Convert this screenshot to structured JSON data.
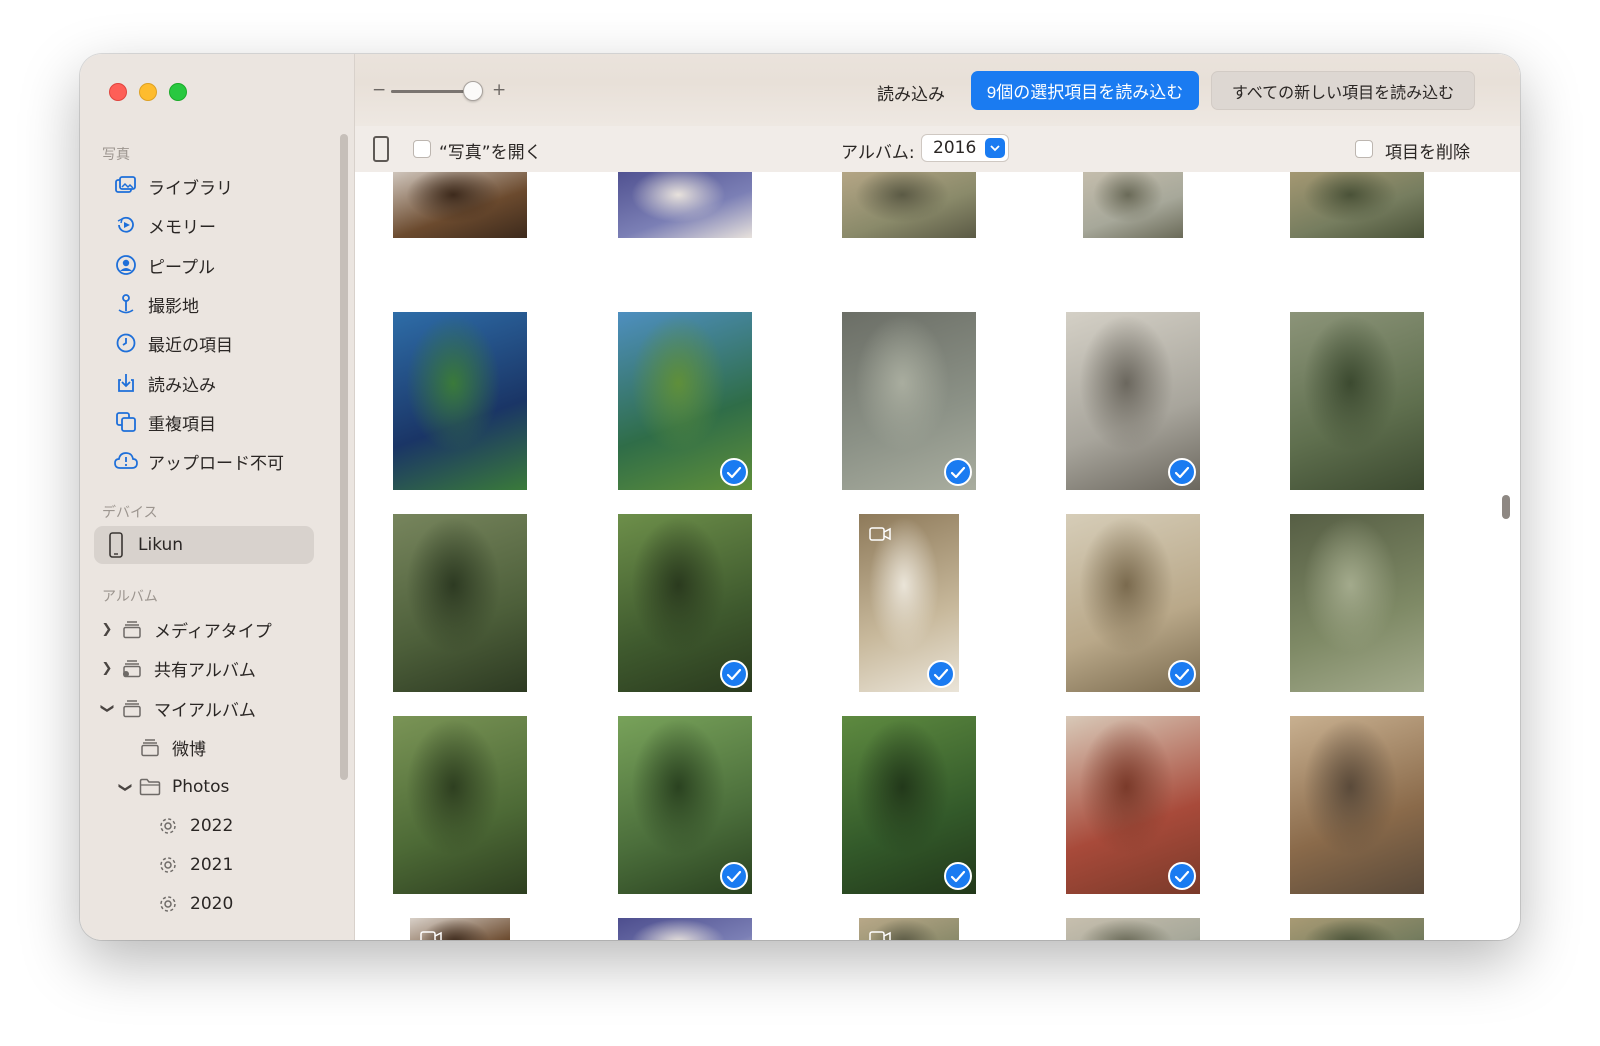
{
  "sidebar": {
    "sections": {
      "photos": "写真",
      "devices": "デバイス",
      "albums": "アルバム"
    },
    "library_items": [
      {
        "label": "ライブラリ",
        "icon": "library-icon"
      },
      {
        "label": "メモリー",
        "icon": "memories-icon"
      },
      {
        "label": "ピープル",
        "icon": "people-icon"
      },
      {
        "label": "撮影地",
        "icon": "places-icon"
      },
      {
        "label": "最近の項目",
        "icon": "recents-icon"
      },
      {
        "label": "読み込み",
        "icon": "imports-icon"
      },
      {
        "label": "重複項目",
        "icon": "duplicates-icon"
      },
      {
        "label": "アップロード不可",
        "icon": "upload-error-icon"
      }
    ],
    "device": {
      "label": "Likun",
      "icon": "iphone-icon"
    },
    "album_items": [
      {
        "label": "メディアタイプ",
        "expanded": false,
        "icon": "album-stack-icon"
      },
      {
        "label": "共有アルバム",
        "expanded": false,
        "icon": "shared-album-icon"
      },
      {
        "label": "マイアルバム",
        "expanded": true,
        "icon": "album-stack-icon"
      },
      {
        "label": "微博",
        "icon": "album-stack-icon"
      },
      {
        "label": "Photos",
        "expanded": true,
        "icon": "folder-icon"
      },
      {
        "label": "2022",
        "icon": "smart-album-gear-icon"
      },
      {
        "label": "2021",
        "icon": "smart-album-gear-icon"
      },
      {
        "label": "2020",
        "icon": "smart-album-gear-icon"
      }
    ]
  },
  "toolbar": {
    "zoom_minus": "−",
    "zoom_plus": "+",
    "zoom_level": 0.9,
    "import_label": "読み込み",
    "import_selected_label": "9個の選択項目を読み込む",
    "import_all_new_label": "すべての新しい項目を読み込む"
  },
  "subbar": {
    "open_photos_label": "“写真”を開く",
    "album_label": "アルバム:",
    "album_value": "2016",
    "delete_items_label": "項目を削除"
  },
  "grid": {
    "selected_count": 9,
    "rows": [
      [
        {
          "sel": false
        },
        {
          "sel": false
        },
        {
          "sel": false
        },
        {
          "sel": false
        },
        {
          "sel": false
        }
      ],
      [
        {
          "sel": false
        },
        {
          "sel": true
        },
        {
          "sel": true
        },
        {
          "sel": true
        },
        {
          "sel": false
        }
      ],
      [
        {
          "sel": false
        },
        {
          "sel": true
        },
        {
          "sel": true,
          "video": true
        },
        {
          "sel": true
        },
        {
          "sel": false
        }
      ],
      [
        {
          "sel": false
        },
        {
          "sel": true
        },
        {
          "sel": true
        },
        {
          "sel": true
        },
        {
          "sel": false
        }
      ],
      [
        {
          "sel": false,
          "video": true
        },
        {
          "sel": false
        },
        {
          "sel": false,
          "video": true
        },
        {
          "sel": false
        },
        {
          "sel": false
        }
      ]
    ]
  },
  "colors": {
    "accent": "#1a7bf1",
    "sidebar_bg": "#ebe5e0"
  }
}
